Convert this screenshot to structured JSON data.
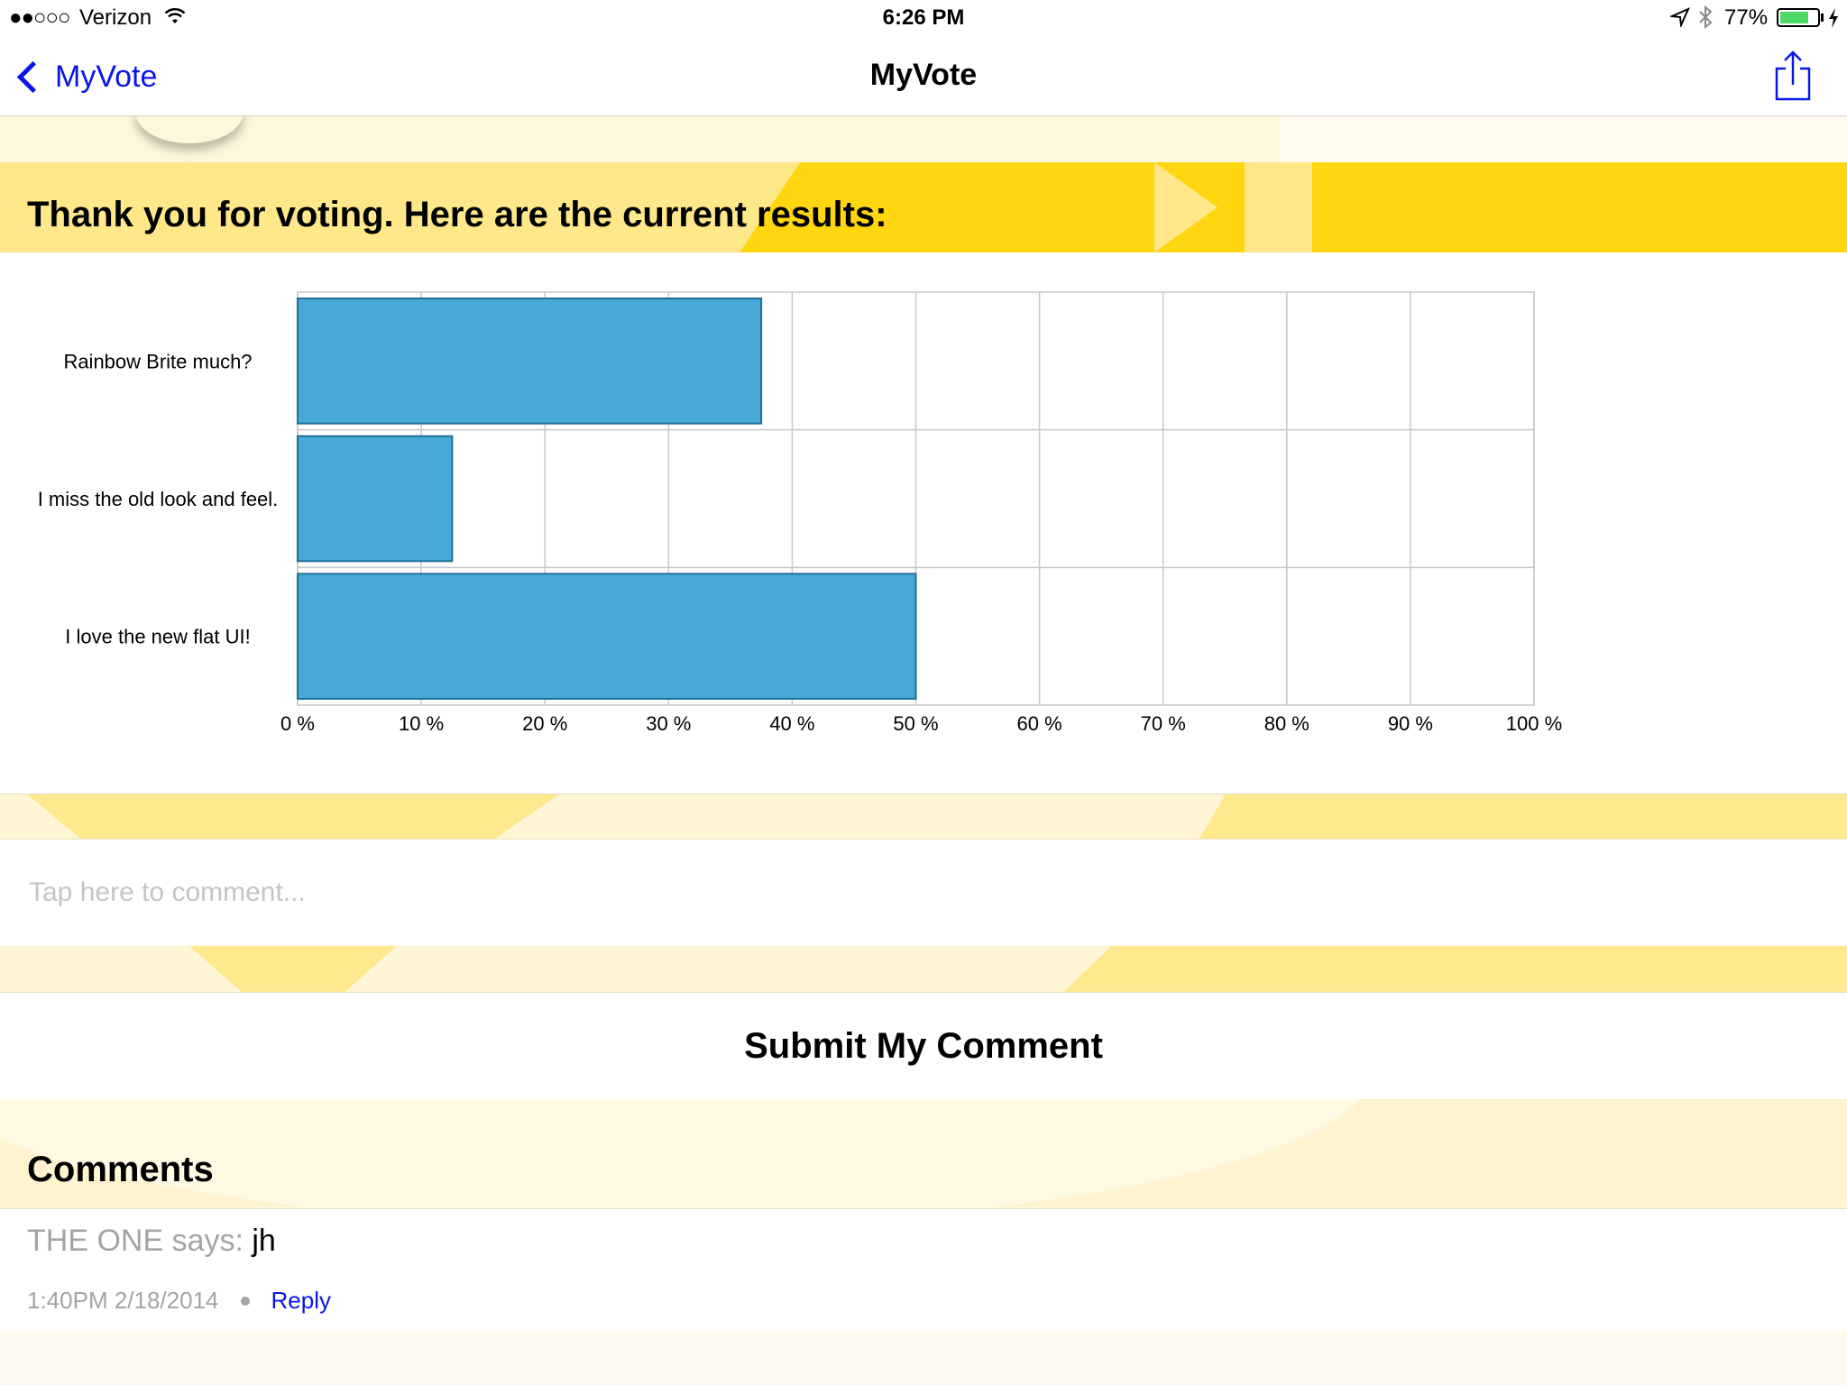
{
  "status_bar": {
    "signal": "●●○○○",
    "carrier": "Verizon",
    "time": "6:26 PM",
    "battery_percent": "77%",
    "battery_level": 0.77,
    "icons": [
      "wifi-icon",
      "location-icon",
      "bluetooth-icon",
      "battery-icon",
      "charging-icon"
    ]
  },
  "nav": {
    "back_label": "MyVote",
    "title": "MyVote",
    "share_icon": "share-icon",
    "accent_color": "#0a16e6"
  },
  "results": {
    "heading": "Thank you for voting. Here are the current results:"
  },
  "chart_data": {
    "type": "bar",
    "orientation": "horizontal",
    "categories": [
      "Rainbow Brite much?",
      "I miss the old look and feel.",
      "I love the new flat UI!"
    ],
    "values": [
      37.5,
      12.5,
      50
    ],
    "xlim": [
      0,
      100
    ],
    "x_ticks": [
      "0 %",
      "10 %",
      "20 %",
      "30 %",
      "40 %",
      "50 %",
      "60 %",
      "70 %",
      "80 %",
      "90 %",
      "100 %"
    ],
    "grid": true,
    "bar_color": "#46a9d6",
    "bar_border_color": "#1f6f98"
  },
  "comment_form": {
    "placeholder": "Tap here to comment...",
    "value": "",
    "submit_label": "Submit My Comment"
  },
  "comments": {
    "title": "Comments",
    "items": [
      {
        "author": "THE ONE",
        "says": " says: ",
        "text": "jh",
        "timestamp": "1:40PM 2/18/2014",
        "reply_label": "Reply"
      }
    ]
  }
}
